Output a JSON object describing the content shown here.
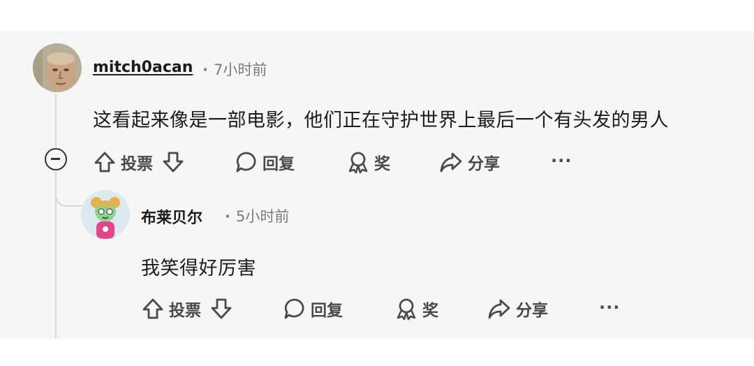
{
  "comments": [
    {
      "username": "mitch0acan",
      "time": "7小时前",
      "body": "这看起来像是一部电影，他们正在守护世界上最后一个有头发的男人",
      "actions": {
        "vote": "投票",
        "reply": "回复",
        "award": "奖",
        "share": "分享",
        "more": "···"
      }
    },
    {
      "username": "布莱贝尔",
      "time": "5小时前",
      "body": "我笑得好厉害",
      "actions": {
        "vote": "投票",
        "reply": "回复",
        "award": "奖",
        "share": "分享",
        "more": "···"
      }
    }
  ],
  "colors": {
    "panel_bg": "#f6f6f6",
    "text": "#1c1c1c",
    "meta": "#7c7c7c",
    "thread_line": "#d8d8d8"
  }
}
